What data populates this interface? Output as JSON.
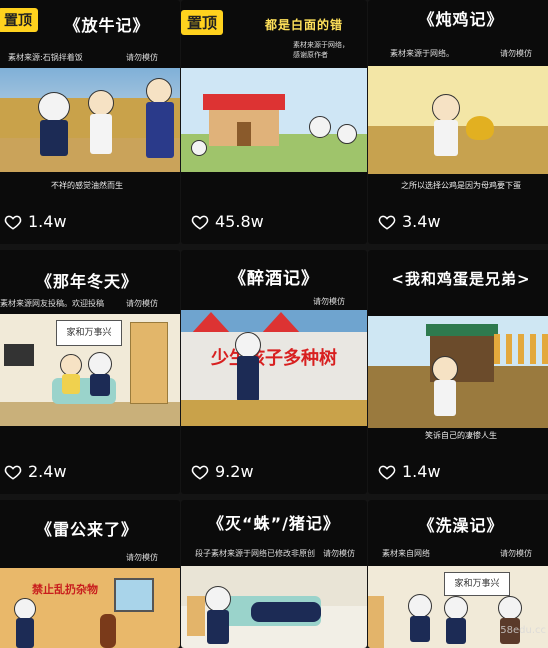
{
  "pin_label": "置顶",
  "watermark": "58edu.cc",
  "cards": [
    {
      "title": "《放牛记》",
      "source": "素材来源:石锅拌着饭",
      "warning": "请勿模仿",
      "caption": "不祥的感觉油然而生",
      "likes": "1.4w",
      "pinned": true
    },
    {
      "title": "都是白面的错",
      "source": "素材来源于网络，感谢原作者",
      "warning": "",
      "caption": "",
      "likes": "45.8w",
      "pinned": true
    },
    {
      "title": "《炖鸡记》",
      "source": "素材来源于网络。",
      "warning": "请勿模仿",
      "caption": "之所以选择公鸡是因为母鸡要下蛋",
      "likes": "3.4w",
      "pinned": false
    },
    {
      "title": "《那年冬天》",
      "source": "素材来源网友投稿。欢迎投稿",
      "warning": "请勿模仿",
      "caption": "",
      "likes": "2.4w",
      "pinned": false,
      "sign": "家和万事兴"
    },
    {
      "title": "《醉酒记》",
      "source": "",
      "warning": "请勿模仿",
      "caption": "",
      "likes": "9.2w",
      "pinned": false,
      "banner": "少生孩子多种树"
    },
    {
      "title": "<我和鸡蛋是兄弟>",
      "source": "",
      "warning": "",
      "caption": "笑诉自己的凄惨人生",
      "likes": "1.4w",
      "pinned": false
    },
    {
      "title": "《雷公来了》",
      "source": "",
      "warning": "请勿模仿",
      "caption": "",
      "likes": "",
      "pinned": false,
      "sign": "禁止乱扔杂物"
    },
    {
      "title": "《灭“蛛”/猪记》",
      "source": "段子素材来源于网络已修改非原创",
      "warning": "请勿模仿",
      "caption": "",
      "likes": "",
      "pinned": false
    },
    {
      "title": "《洗澡记》",
      "source": "素材来自网络",
      "warning": "请勿模仿",
      "caption": "",
      "likes": "",
      "pinned": false,
      "sign": "家和万事兴"
    }
  ]
}
